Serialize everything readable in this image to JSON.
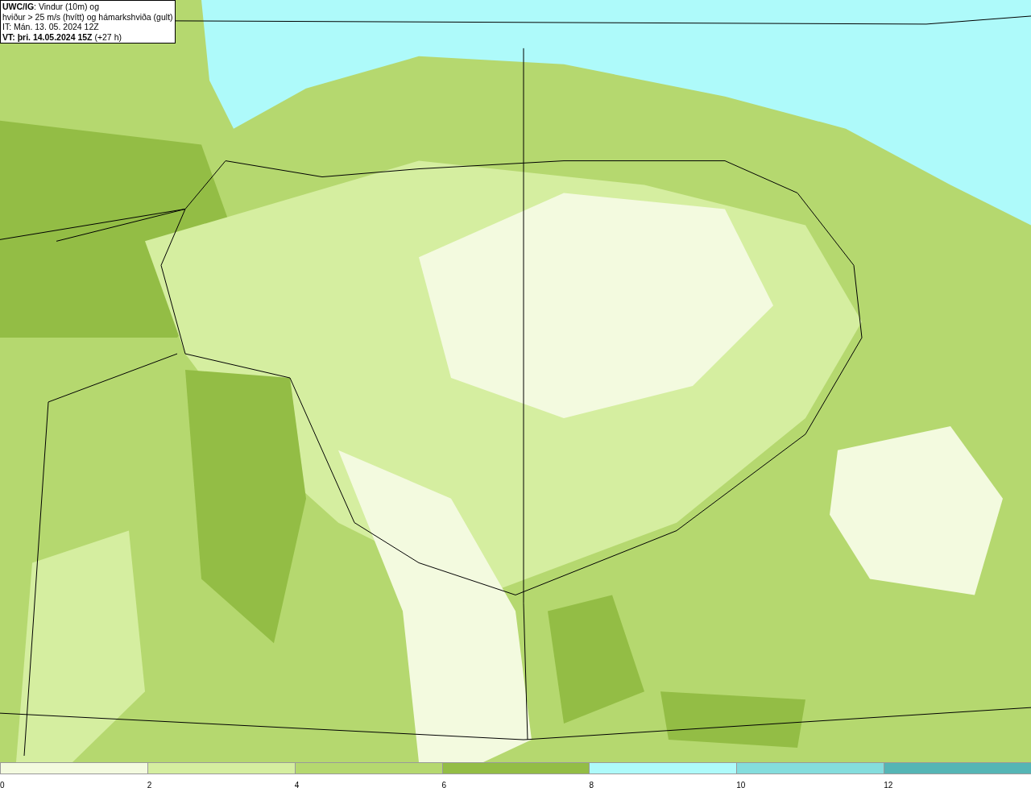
{
  "title_box": {
    "lines": [
      "**UWC/IG**: Vindur (10m) og",
      "hviður > 25 m/s (hvítt) og hámarkshviða (gult)",
      "IT: Mán. 13. 05. 2024 12Z",
      "**VT: þri. 14.05.2024 15Z** (+27 h)"
    ]
  },
  "legend": {
    "segments": [
      {
        "color": "#f3fadf"
      },
      {
        "color": "#d5eea0"
      },
      {
        "color": "#b5d86f"
      },
      {
        "color": "#93bd45"
      },
      {
        "color": "#aefafa"
      },
      {
        "color": "#84dddd"
      },
      {
        "color": "#55b5b5"
      }
    ],
    "ticks": [
      "0",
      "2",
      "4",
      "6",
      "8",
      "10",
      "12"
    ]
  }
}
